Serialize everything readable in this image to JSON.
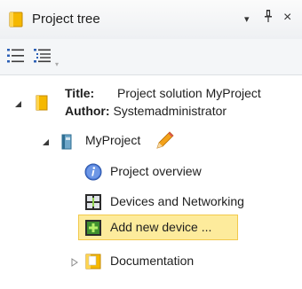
{
  "panel": {
    "title": "Project tree",
    "menu_glyph": "▾",
    "pin_glyph": "ꟷ",
    "close_glyph": "×"
  },
  "toolbar": {
    "tool1_icon": "list-view-icon",
    "tool2_icon": "detail-list-view-icon",
    "dropdown_glyph": "▾"
  },
  "tree": {
    "root": {
      "title_key": "Title:",
      "title_value": "Project solution MyProject",
      "author_key": "Author:",
      "author_value": "Systemadministrator",
      "icon": "project-solution-icon"
    },
    "project": {
      "label": "MyProject",
      "icon": "project-icon",
      "edit_icon": "pencil-icon"
    },
    "items": [
      {
        "label": "Project overview",
        "icon": "info-icon"
      },
      {
        "label": "Devices and Networking",
        "icon": "devices-networking-icon"
      },
      {
        "label": "Add new device ...",
        "icon": "add-device-icon",
        "selected": true
      },
      {
        "label": "Documentation",
        "icon": "documentation-icon"
      }
    ]
  },
  "colors": {
    "selection_bg": "#fdeb9c",
    "selection_border": "#f2c94c",
    "folder_yellow": "#f5b800",
    "info_blue": "#4a78d6"
  }
}
